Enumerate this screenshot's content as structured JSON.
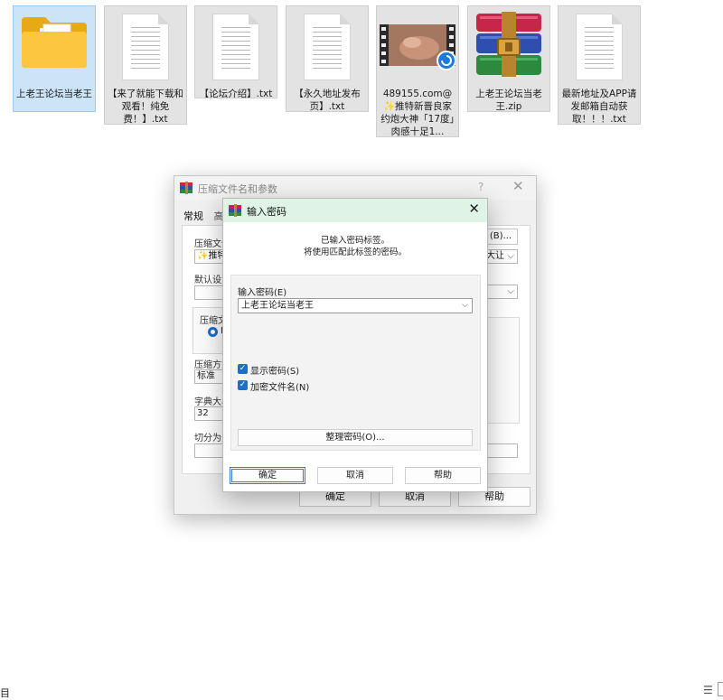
{
  "desktop": {
    "files": [
      {
        "label": "上老王论坛当老王",
        "type": "folder"
      },
      {
        "label": "【来了就能下载和观看！纯免费！】.txt",
        "type": "txt"
      },
      {
        "label": "【论坛介绍】.txt",
        "type": "txt"
      },
      {
        "label": "【永久地址发布页】.txt",
        "type": "txt"
      },
      {
        "label": "489155.com@✨推特新晋良家约炮大神「17度」肉感十足1...",
        "type": "video"
      },
      {
        "label": "上老王论坛当老王.zip",
        "type": "zip"
      },
      {
        "label": "最新地址及APP请发邮箱自动获取！！！.txt",
        "type": "txt"
      }
    ]
  },
  "archive_dialog": {
    "title": "压缩文件名和参数",
    "help_glyph": "?",
    "tab_general": "常规",
    "tab_advanced": "高",
    "label_archive_name": "压缩文件",
    "archive_name_value": "✨推特",
    "browse_button": "(B)...",
    "update_mode_value": "大让",
    "label_default": "默认设置",
    "label_format": "压缩文",
    "radio_value": "R",
    "label_method": "压缩方式",
    "method_value": "标准",
    "label_dict": "字典大小",
    "dict_value": "32",
    "label_split": "切分为分",
    "ok": "确定",
    "cancel": "取消",
    "help": "帮助"
  },
  "password_dialog": {
    "title": "输入密码",
    "msg_line1": "已输入密码标签。",
    "msg_line2": "将使用匹配此标签的密码。",
    "field_label": "输入密码(E)",
    "password_value": "上老王论坛当老王",
    "show_password": "显示密码(S)",
    "encrypt_names": "加密文件名(N)",
    "organize_button": "整理密码(O)...",
    "ok": "确定",
    "cancel": "取消",
    "help": "帮助"
  },
  "bottom": {
    "left_glyph": "目",
    "right_glyph": "☰"
  }
}
